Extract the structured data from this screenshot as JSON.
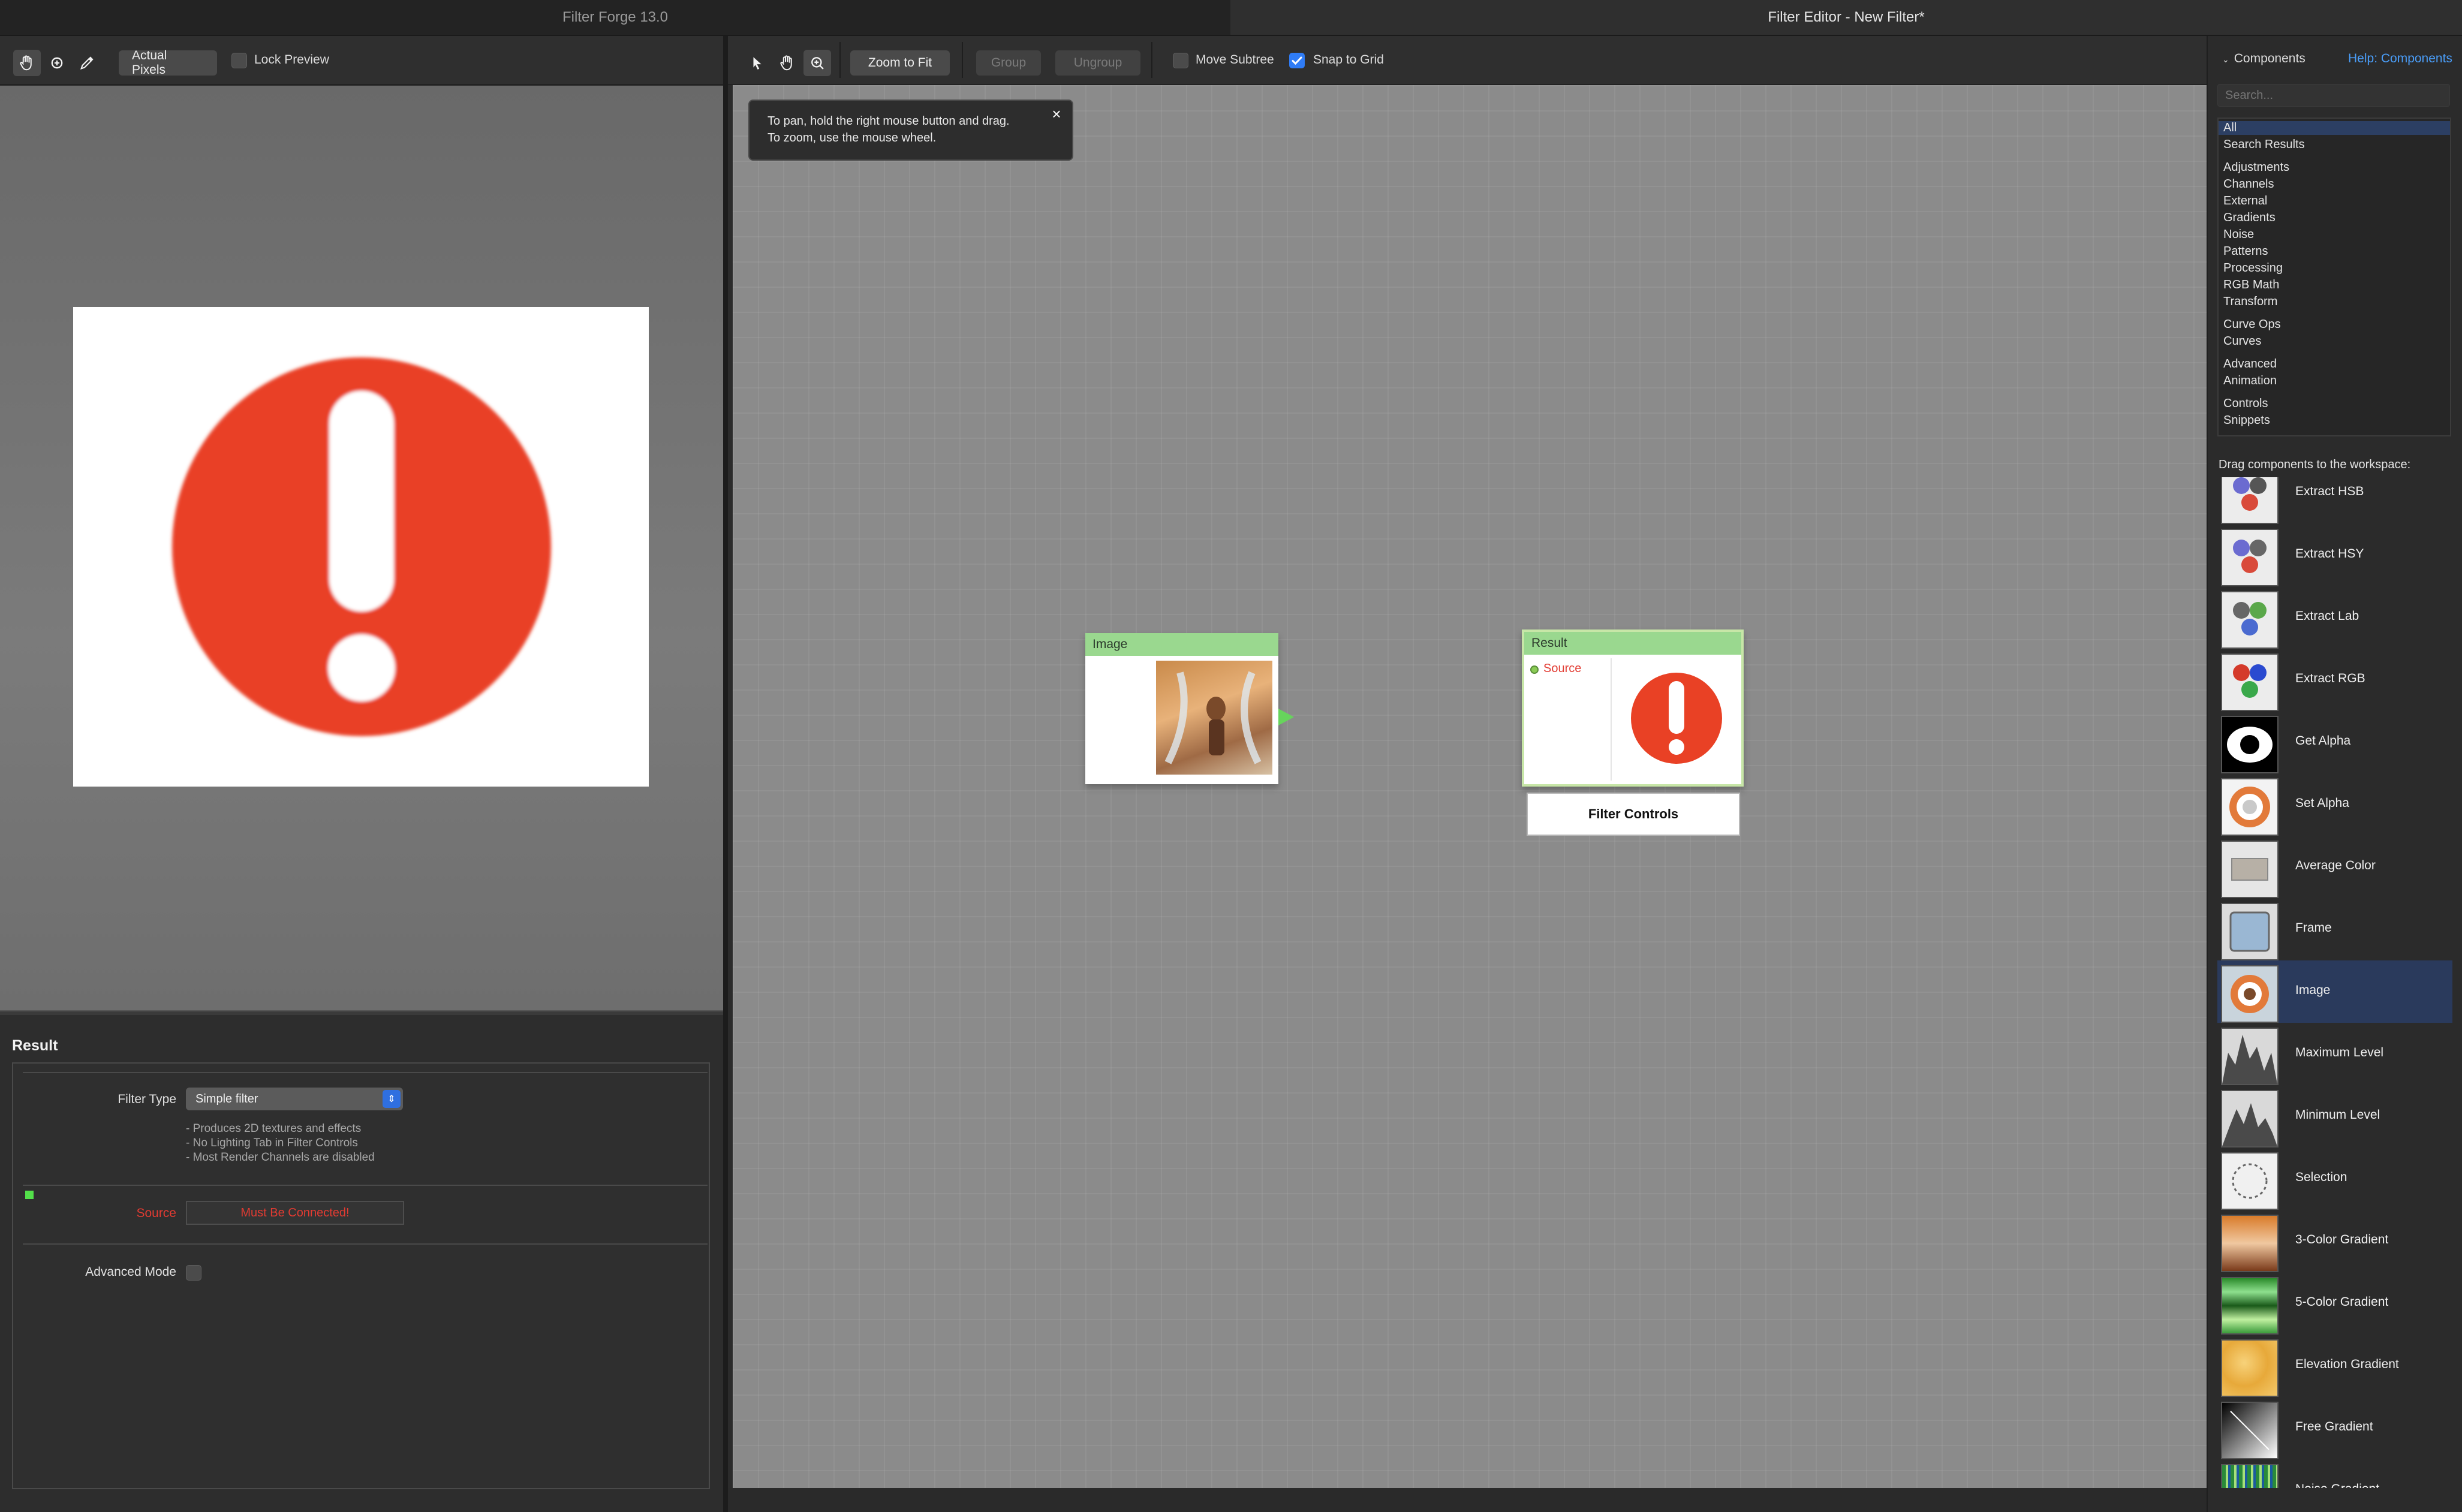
{
  "titlebar": {
    "left": "Filter Forge 13.0",
    "right": "Filter Editor - New Filter*"
  },
  "left_toolbar": {
    "actual_pixels": "Actual Pixels",
    "lock_preview": "Lock Preview"
  },
  "properties": {
    "title": "Result",
    "filter_type_label": "Filter Type",
    "filter_type_value": "Simple filter",
    "description": [
      "- Produces 2D textures and effects",
      "- No Lighting Tab in Filter Controls",
      "- Most Render Channels are disabled"
    ],
    "source_label": "Source",
    "source_status": "Must Be Connected!",
    "advanced_mode_label": "Advanced Mode"
  },
  "editor_toolbar": {
    "zoom_to_fit": "Zoom to Fit",
    "group": "Group",
    "ungroup": "Ungroup",
    "move_subtree": "Move Subtree",
    "snap_to_grid": "Snap to Grid"
  },
  "tooltip": {
    "line1": "To pan, hold the right mouse button and drag.",
    "line2": "To zoom, use the mouse wheel."
  },
  "nodes": {
    "image": {
      "title": "Image"
    },
    "result": {
      "title": "Result",
      "source_port": "Source"
    },
    "filter_controls": "Filter Controls"
  },
  "components": {
    "header": "Components",
    "help_link": "Help: Components",
    "search_placeholder": "Search...",
    "categories": [
      "All",
      "Search Results",
      "Adjustments",
      "Channels",
      "External",
      "Gradients",
      "Noise",
      "Patterns",
      "Processing",
      "RGB Math",
      "Transform",
      "Curve Ops",
      "Curves",
      "Advanced",
      "Animation",
      "Controls",
      "Snippets"
    ],
    "drag_hint": "Drag components to the workspace:",
    "items": [
      "Extract HSB",
      "Extract HSY",
      "Extract Lab",
      "Extract RGB",
      "Get Alpha",
      "Set Alpha",
      "Average Color",
      "Frame",
      "Image",
      "Maximum Level",
      "Minimum Level",
      "Selection",
      "3-Color Gradient",
      "5-Color Gradient",
      "Elevation Gradient",
      "Free Gradient",
      "Noise Gradient"
    ]
  },
  "colors": {
    "accent_blue": "#2f7cf6",
    "node_header_green": "#9ad88f",
    "error_red": "#e23b32",
    "alert_red": "#e94125"
  }
}
